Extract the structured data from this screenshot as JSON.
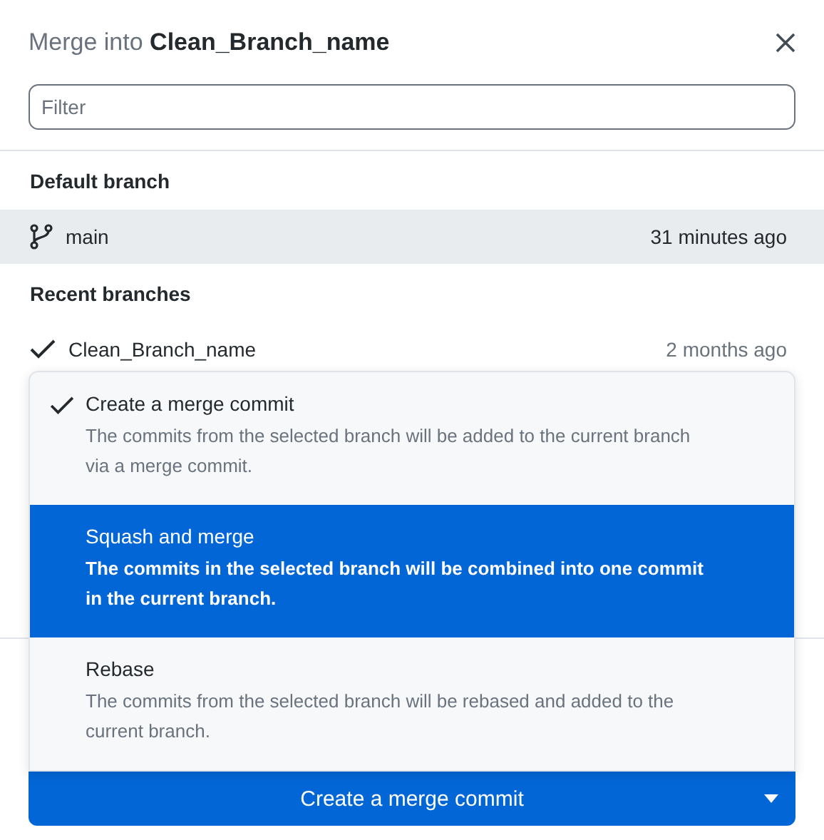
{
  "dialog": {
    "title_prefix": "Merge into",
    "title_branch": "Clean_Branch_name"
  },
  "filter": {
    "placeholder": "Filter"
  },
  "sections": [
    {
      "heading": "Default branch",
      "branches": [
        {
          "name": "main",
          "time": "31 minutes ago",
          "kind": "default",
          "highlighted": true
        }
      ]
    },
    {
      "heading": "Recent branches",
      "branches": [
        {
          "name": "Clean_Branch_name",
          "time": "2 months ago",
          "kind": "current",
          "highlighted": false
        }
      ]
    }
  ],
  "merge_menu": [
    {
      "title": "Create a merge commit",
      "description": "The commits from the selected branch will be added to the current branch via a merge commit.",
      "checked": true,
      "selected": false
    },
    {
      "title": "Squash and merge",
      "description": "The commits in the selected branch will be combined into one commit in the current branch.",
      "checked": false,
      "selected": true
    },
    {
      "title": "Rebase",
      "description": "The commits from the selected branch will be rebased and added to the current branch.",
      "checked": false,
      "selected": false
    }
  ],
  "merge_button": {
    "label": "Create a merge commit"
  }
}
